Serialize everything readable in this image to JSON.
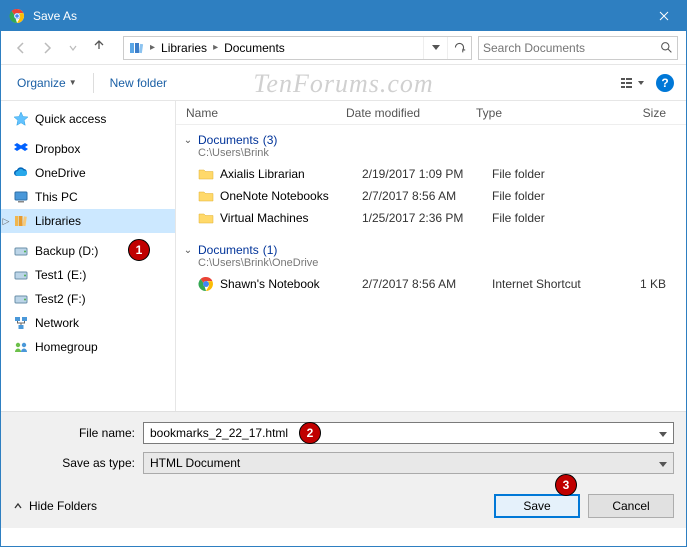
{
  "window": {
    "title": "Save As"
  },
  "breadcrumb": {
    "root": "Libraries",
    "current": "Documents"
  },
  "search": {
    "placeholder": "Search Documents"
  },
  "toolbar": {
    "organize": "Organize",
    "new_folder": "New folder"
  },
  "sidebar": {
    "items": [
      {
        "label": "Quick access",
        "icon": "star"
      },
      {
        "label": "Dropbox",
        "icon": "dropbox"
      },
      {
        "label": "OneDrive",
        "icon": "onedrive"
      },
      {
        "label": "This PC",
        "icon": "thispc"
      },
      {
        "label": "Libraries",
        "icon": "libraries",
        "selected": true
      },
      {
        "label": "Backup (D:)",
        "icon": "drive"
      },
      {
        "label": "Test1 (E:)",
        "icon": "drive"
      },
      {
        "label": "Test2 (F:)",
        "icon": "drive"
      },
      {
        "label": "Network",
        "icon": "network"
      },
      {
        "label": "Homegroup",
        "icon": "homegroup"
      }
    ]
  },
  "columns": {
    "name": "Name",
    "date": "Date modified",
    "type": "Type",
    "size": "Size"
  },
  "groups": [
    {
      "title": "Documents",
      "count_label": "(3)",
      "path": "C:\\Users\\Brink",
      "rows": [
        {
          "name": "Axialis Librarian",
          "date": "2/19/2017 1:09 PM",
          "type": "File folder",
          "size": "",
          "icon": "folder"
        },
        {
          "name": "OneNote Notebooks",
          "date": "2/7/2017 8:56 AM",
          "type": "File folder",
          "size": "",
          "icon": "folder"
        },
        {
          "name": "Virtual Machines",
          "date": "1/25/2017 2:36 PM",
          "type": "File folder",
          "size": "",
          "icon": "folder"
        }
      ]
    },
    {
      "title": "Documents",
      "count_label": "(1)",
      "path": "C:\\Users\\Brink\\OneDrive",
      "rows": [
        {
          "name": "Shawn's Notebook",
          "date": "2/7/2017 8:56 AM",
          "type": "Internet Shortcut",
          "size": "1 KB",
          "icon": "chrome"
        }
      ]
    }
  ],
  "footer": {
    "filename_label": "File name:",
    "filename_value": "bookmarks_2_22_17.html",
    "type_label": "Save as type:",
    "type_value": "HTML Document",
    "hide_folders": "Hide Folders",
    "save": "Save",
    "cancel": "Cancel"
  },
  "watermark": "TenForums.com",
  "callouts": {
    "c1": "1",
    "c2": "2",
    "c3": "3"
  }
}
